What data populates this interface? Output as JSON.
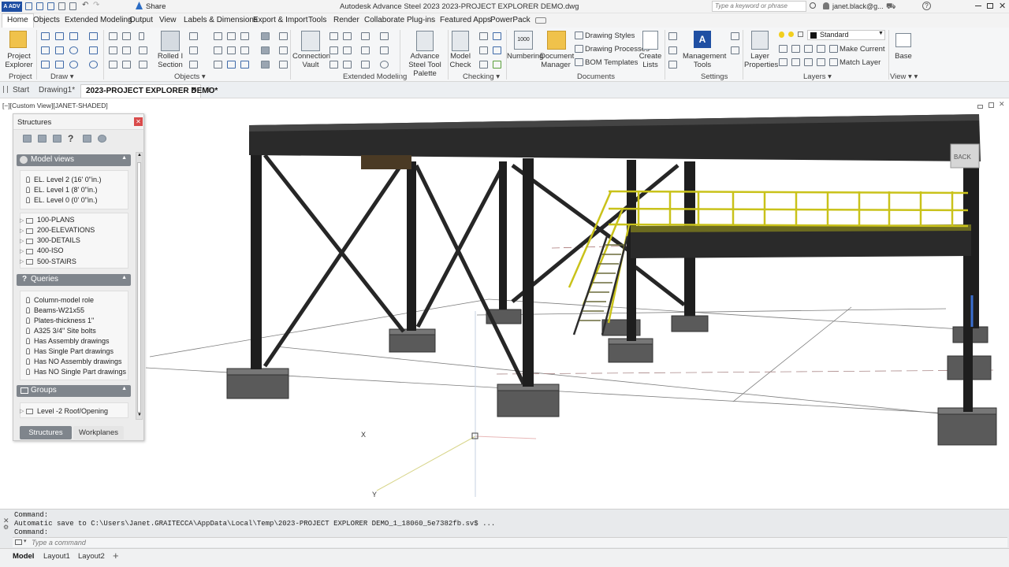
{
  "title_bar": {
    "app_logo": "A ADV",
    "share_label": "Share",
    "title": "Autodesk Advance Steel 2023    2023-PROJECT EXPLORER DEMO.dwg",
    "search_placeholder": "Type a keyword or phrase",
    "user": "janet.black@g..."
  },
  "menu": [
    "Home",
    "Objects",
    "Extended Modeling",
    "Output",
    "View",
    "Labels & Dimensions",
    "Export & Import",
    "Tools",
    "Render",
    "Collaborate",
    "Plug-ins",
    "Featured Apps",
    "PowerPack"
  ],
  "ribbon": {
    "project_explorer": "Project Explorer",
    "rolled_section": "Rolled I Section",
    "connection_vault": "Connection Vault",
    "tool_palette": "Advance Steel Tool Palette",
    "model_check": "Model Check",
    "numbering": "Numbering",
    "document_manager": "Document Manager",
    "drawing_styles": "Drawing Styles",
    "drawing_processes": "Drawing Processes",
    "bom_templates": "BOM Templates",
    "create_lists": "Create Lists",
    "management_tools": "Management Tools",
    "layer_properties": "Layer Properties",
    "layer_name": "Standard",
    "make_current": "Make Current",
    "match_layer": "Match Layer",
    "base": "Base",
    "numbering_value": "1000",
    "groups": {
      "project": "Project",
      "draw": "Draw",
      "objects": "Objects",
      "extended": "Extended Modeling",
      "checking": "Checking",
      "documents": "Documents",
      "settings": "Settings",
      "layers": "Layers",
      "view": "View"
    }
  },
  "doc_tabs": {
    "start": "Start",
    "drawing1": "Drawing1*",
    "active": "2023-PROJECT EXPLORER DEMO*"
  },
  "viewport": {
    "label": "[−][Custom View][JANET-SHADED]",
    "viewcube": "BACK",
    "x_axis": "X",
    "y_axis": "Y"
  },
  "panel": {
    "title": "Structures",
    "model_views_header": "Model views",
    "model_views": [
      "EL. Level 2 (16' 0\"in.)",
      "EL. Level 1 (8' 0\"in.)",
      "EL. Level 0 (0' 0\"in.)"
    ],
    "folders": [
      "100-PLANS",
      "200-ELEVATIONS",
      "300-DETAILS",
      "400-ISO",
      "500-STAIRS"
    ],
    "queries_header": "Queries",
    "queries": [
      "Column-model role",
      "Beams-W21x55",
      "Plates-thickness 1\"",
      "A325 3/4\" Site bolts",
      "Has Assembly drawings",
      "Has Single Part drawings",
      "Has NO Assembly drawings",
      "Has NO Single Part drawings"
    ],
    "groups_header": "Groups",
    "groups": [
      "Level -2 Roof/Opening"
    ],
    "tab_structures": "Structures",
    "tab_workplanes": "Workplanes"
  },
  "command": {
    "line1": "Command:",
    "line2": "Automatic save to C:\\Users\\Janet.GRAITECCA\\AppData\\Local\\Temp\\2023-PROJECT EXPLORER DEMO_1_18060_5e7382fb.sv$ ...",
    "line3": "Command:",
    "placeholder": "Type a command"
  },
  "layout_tabs": [
    "Model",
    "Layout1",
    "Layout2"
  ],
  "colors": {
    "steel": "#1e1e1e",
    "railing": "#c9c21a",
    "footing": "#5a5a5a",
    "accent": "#0a5ec0"
  }
}
